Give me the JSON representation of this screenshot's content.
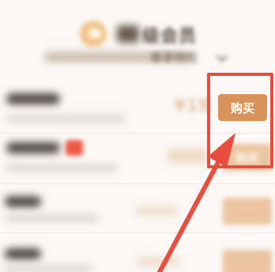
{
  "header": {
    "title": "级会员",
    "subtitle_suffix": "尊享特权"
  },
  "plans": [
    {
      "price_text": "¥19",
      "buy_label": "购买"
    },
    {
      "buy_label": "购买"
    },
    {
      "buy_label": ""
    },
    {
      "buy_label": ""
    }
  ],
  "colors": {
    "buy_button": "#d9935a",
    "highlight": "#ea4d3d",
    "tag": "#ee5a48"
  },
  "icons": {
    "header": "vip-emblem-icon",
    "dropdown": "chevron-down-icon",
    "annotation": "arrow-icon"
  }
}
